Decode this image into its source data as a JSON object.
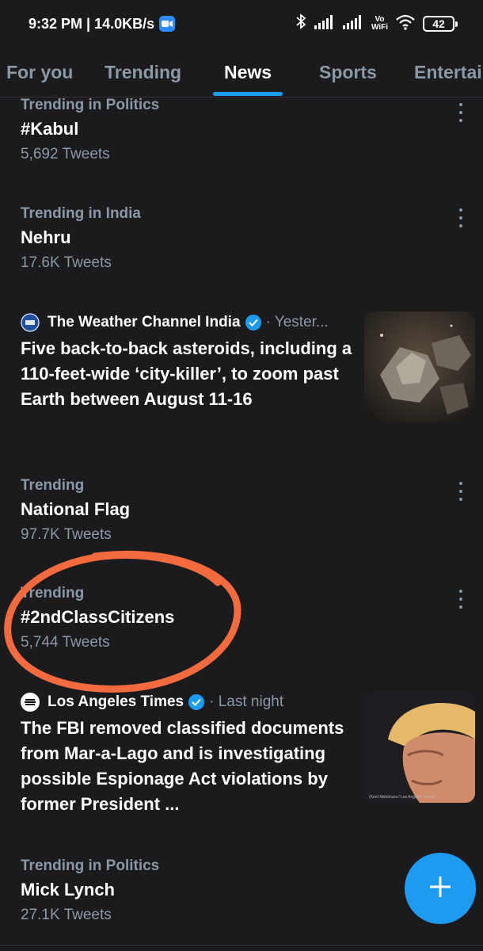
{
  "status_bar": {
    "time_speed": "9:32 PM | 14.0KB/s",
    "vowifi_top": "Vo",
    "vowifi_bottom": "WiFi",
    "battery": "42"
  },
  "tabs": [
    {
      "label": "For you",
      "active": false
    },
    {
      "label": "Trending",
      "active": false
    },
    {
      "label": "News",
      "active": true
    },
    {
      "label": "Sports",
      "active": false
    },
    {
      "label": "Entertai",
      "active": false
    }
  ],
  "trends": [
    {
      "context": "Trending in Politics",
      "topic": "#Kabul",
      "count": "5,692 Tweets"
    },
    {
      "context": "Trending in India",
      "topic": "Nehru",
      "count": "17.6K Tweets"
    },
    {
      "context": "Trending",
      "topic": "National Flag",
      "count": "97.7K Tweets"
    },
    {
      "context": "Trending",
      "topic": "#2ndClassCitizens",
      "count": "5,744 Tweets"
    },
    {
      "context": "Trending in Politics",
      "topic": "Mick Lynch",
      "count": "27.1K Tweets"
    }
  ],
  "news": [
    {
      "source": "The Weather Channel India",
      "avatar_text": "The Weather Channel",
      "time": "· Yester...",
      "headline": "Five back-to-back asteroids, including a 110-feet-wide ‘city-killer’, to zoom past Earth between August 11-16"
    },
    {
      "source": "Los Angeles Times",
      "avatar_text": "Los Angeles Times",
      "time": "· Last night",
      "headline": "The FBI removed classified documents from Mar-a-Lago and is investigating possible Espionage Act violations by former President ...",
      "photo_credit": "(Kent Nishimura / Los Angeles Times)"
    }
  ],
  "colors": {
    "background": "#1b1b1d",
    "accent": "#1d9bf0",
    "muted_text": "#8b98a5",
    "annotation": "#f26a3d"
  },
  "icons": {
    "more": "more-vertical-icon",
    "verified": "verified-badge-icon",
    "compose": "plus-icon",
    "bluetooth": "bluetooth-icon",
    "signal": "signal-icon",
    "wifi": "wifi-icon"
  }
}
